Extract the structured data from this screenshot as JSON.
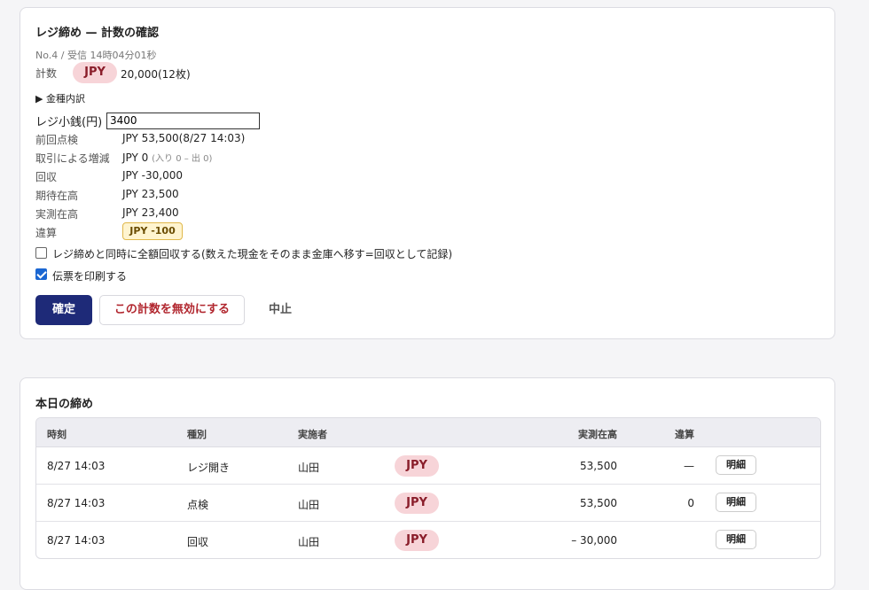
{
  "close": {
    "title": "レジ締め — 計数の確認",
    "meta": "No.4 / 受信 14時04分01秒",
    "count_label": "計数",
    "currency": "JPY",
    "count_value": "20,000(12枚)",
    "denom_toggle": "▶ 金種内訳",
    "float_label": "レジ小銭(円)",
    "float_value": "3400",
    "rows": [
      {
        "label": "前回点検",
        "value": "JPY 53,500(8/27 14:03)",
        "sub": ""
      },
      {
        "label": "取引による増減",
        "value": "JPY 0",
        "sub": "(入り 0 – 出 0)"
      },
      {
        "label": "回収",
        "value": "JPY -30,000",
        "sub": ""
      },
      {
        "label": "期待在高",
        "value": "JPY 23,500",
        "sub": ""
      },
      {
        "label": "実測在高",
        "value": "JPY 23,400",
        "sub": ""
      }
    ],
    "diff_label": "違算",
    "diff_value": "JPY -100",
    "checkbox_collect": "レジ締めと同時に全額回収する(数えた現金をそのまま金庫へ移す=回収として記録)",
    "checkbox_collect_checked": false,
    "checkbox_print": "伝票を印刷する",
    "checkbox_print_checked": true,
    "btn_confirm": "確定",
    "btn_invalidate": "この計数を無効にする",
    "btn_cancel": "中止"
  },
  "today": {
    "title": "本日の締め",
    "headers": [
      "時刻",
      "種別",
      "実施者",
      "",
      "実測在高",
      "違算",
      ""
    ],
    "rows": [
      {
        "time": "8/27 14:03",
        "type": "レジ開き",
        "by": "山田",
        "currency": "JPY",
        "amount": "53,500",
        "diff": "—",
        "action": "明細"
      },
      {
        "time": "8/27 14:03",
        "type": "点検",
        "by": "山田",
        "currency": "JPY",
        "amount": "53,500",
        "diff": "0",
        "action": "明細"
      },
      {
        "time": "8/27 14:03",
        "type": "回収",
        "by": "山田",
        "currency": "JPY",
        "amount": "– 30,000",
        "diff": "",
        "action": "明細"
      }
    ]
  },
  "colors": {
    "primary": "#1e2a78",
    "danger": "#b1262e",
    "pill_bg": "#f7d4d8",
    "pill_text": "#8a1d2a",
    "diff_bg": "#fff4cf"
  }
}
